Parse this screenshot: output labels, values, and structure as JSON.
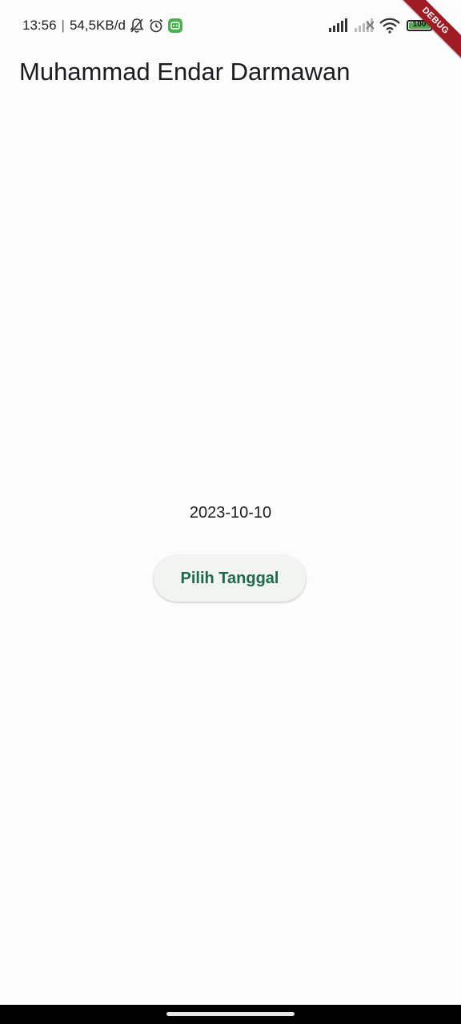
{
  "status_bar": {
    "time": "13:56",
    "separator": "|",
    "network_speed": "54,5KB/d",
    "battery_level": "100",
    "icons": [
      "bell-off-icon",
      "alarm-icon",
      "app-notification-icon",
      "signal-icon",
      "signal-icon-secondary",
      "wifi-icon",
      "battery-icon"
    ]
  },
  "debug_banner": {
    "label": "DEBUG",
    "color": "#a01c25"
  },
  "app_bar": {
    "title": "Muhammad Endar Darmawan"
  },
  "main": {
    "selected_date": "2023-10-10",
    "pick_date_button": "Pilih Tanggal"
  },
  "colors": {
    "background": "#fdfcfd",
    "button_text": "#1b6b4a",
    "button_bg": "#f1f4f1"
  }
}
